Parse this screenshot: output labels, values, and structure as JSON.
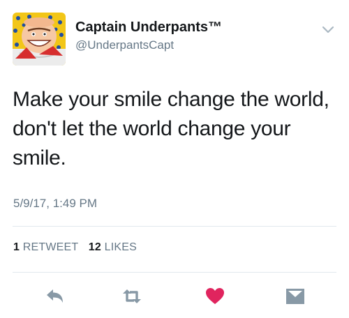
{
  "author": {
    "display_name": "Captain Underpants™",
    "handle": "@UnderpantsCapt",
    "avatar_icon": "captain-underpants-avatar"
  },
  "menu_icon": "chevron-down-icon",
  "tweet": {
    "text": "Make your smile change the world, don't let the world change your smile.",
    "timestamp": "5/9/17, 1:49 PM"
  },
  "stats": {
    "retweets_count": "1",
    "retweets_label": "RETWEET",
    "likes_count": "12",
    "likes_label": "LIKES"
  },
  "actions": [
    {
      "name": "reply",
      "icon": "reply-icon"
    },
    {
      "name": "retweet",
      "icon": "retweet-icon"
    },
    {
      "name": "like",
      "icon": "heart-icon"
    },
    {
      "name": "direct-message",
      "icon": "envelope-icon"
    }
  ],
  "colors": {
    "text": "#14171a",
    "secondary": "#657786",
    "icon": "#8899a6",
    "like": "#e0245e",
    "divider": "#e1e8ed"
  }
}
